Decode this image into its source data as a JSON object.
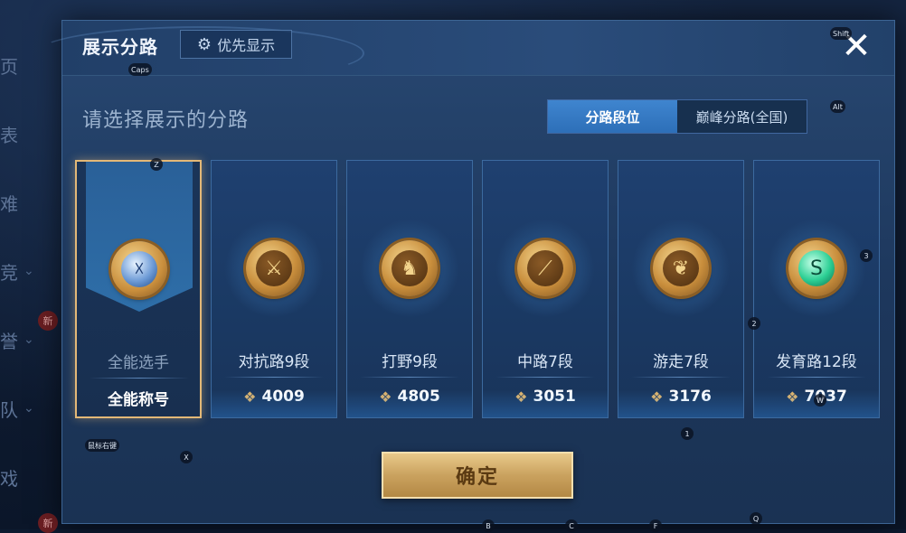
{
  "left_nav": [
    {
      "label": "页",
      "has_chevron": false
    },
    {
      "label": "表",
      "has_chevron": false
    },
    {
      "label": "难",
      "has_chevron": false
    },
    {
      "label": "竞",
      "has_chevron": true
    },
    {
      "label": "誉",
      "has_chevron": true
    },
    {
      "label": "队",
      "has_chevron": true
    },
    {
      "label": "戏",
      "has_chevron": false
    }
  ],
  "left_nav_badge": "新",
  "left_nav_badge_2": "新",
  "dialog": {
    "title": "展示分路",
    "priority_label": "优先显示",
    "close_label": "✕",
    "subtitle": "请选择展示的分路",
    "tabs": [
      {
        "label": "分路段位",
        "active": true
      },
      {
        "label": "巅峰分路(全国)",
        "active": false
      }
    ],
    "cards": [
      {
        "label": "全能选手",
        "points_label": "全能称号",
        "points": "",
        "selected": true,
        "emblem_icon": "versatile-icon",
        "emblem_glyph": "☓",
        "emblem_color": "blue"
      },
      {
        "label": "对抗路9段",
        "points_label": "",
        "points": "4009",
        "selected": false,
        "emblem_icon": "sword-icon",
        "emblem_glyph": "⚔",
        "emblem_color": "gold"
      },
      {
        "label": "打野9段",
        "points_label": "",
        "points": "4805",
        "selected": false,
        "emblem_icon": "dragon-icon",
        "emblem_glyph": "♞",
        "emblem_color": "gold"
      },
      {
        "label": "中路7段",
        "points_label": "",
        "points": "3051",
        "selected": false,
        "emblem_icon": "wand-icon",
        "emblem_glyph": "⟋",
        "emblem_color": "gold"
      },
      {
        "label": "游走7段",
        "points_label": "",
        "points": "3176",
        "selected": false,
        "emblem_icon": "wings-icon",
        "emblem_glyph": "❦",
        "emblem_color": "gold"
      },
      {
        "label": "发育路12段",
        "points_label": "",
        "points": "7037",
        "selected": false,
        "emblem_icon": "marksman-icon",
        "emblem_glyph": "S",
        "emblem_color": "green"
      }
    ],
    "confirm_label": "确定"
  },
  "key_hints": [
    "Caps",
    "Shift",
    "Alt",
    "Z",
    "3",
    "2",
    "1",
    "X",
    "B",
    "C",
    "F",
    "Q",
    "W",
    "鼠标右键"
  ],
  "colors": {
    "accent_gold": "#e3b877",
    "tab_active": "#3f85cf",
    "dialog_bg": "#284872"
  }
}
